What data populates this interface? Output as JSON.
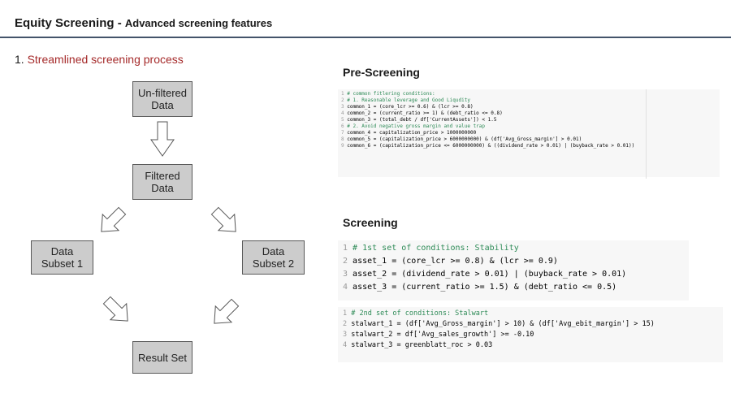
{
  "header": {
    "title_main": "Equity Screening - ",
    "title_sub": "Advanced screening features"
  },
  "section": {
    "number": "1. ",
    "label": "Streamlined screening process"
  },
  "flow": {
    "unfiltered": "Un-filtered\nData",
    "filtered": "Filtered\nData",
    "subset1": "Data\nSubset 1",
    "subset2": "Data\nSubset 2",
    "result": "Result Set"
  },
  "prescreening": {
    "heading": "Pre-Screening",
    "lines": [
      "# common fitlering conditions:",
      "# 1. Reasonable leverage and Good Liqudity",
      "common_1 = (core_lcr >= 0.6) & (lcr >= 0.8)",
      "common_2 = (current_ratio >= 1) & (debt_ratio <= 0.8)",
      "common_3 = (total_debt / df['CurrentAssets']) < 1.5",
      "# 2. Avoid negative gross margin and value trap",
      "common_4 = capitalization_price > 1000000000",
      "common_5 = (capitalization_price > 6000000000) & (df['Avg_Gross_margin'] > 0.01)",
      "common_6 = (capitalization_price <= 6000000000) & ((dividend_rate > 0.01) | (buyback_rate > 0.01))"
    ]
  },
  "screening": {
    "heading": "Screening",
    "block1": [
      "# 1st set of conditions: Stability",
      "asset_1 = (core_lcr >= 0.8) & (lcr >= 0.9)",
      "asset_2 = (dividend_rate > 0.01) | (buyback_rate > 0.01)",
      "asset_3 = (current_ratio >= 1.5) & (debt_ratio <= 0.5)"
    ],
    "block2": [
      "# 2nd set of conditions: Stalwart",
      "stalwart_1 = (df['Avg_Gross_margin'] > 10) & (df['Avg_ebit_margin'] > 15)",
      "stalwart_2 = df['Avg_sales_growth'] >= -0.10",
      "stalwart_3 = greenblatt_roc > 0.03"
    ]
  }
}
